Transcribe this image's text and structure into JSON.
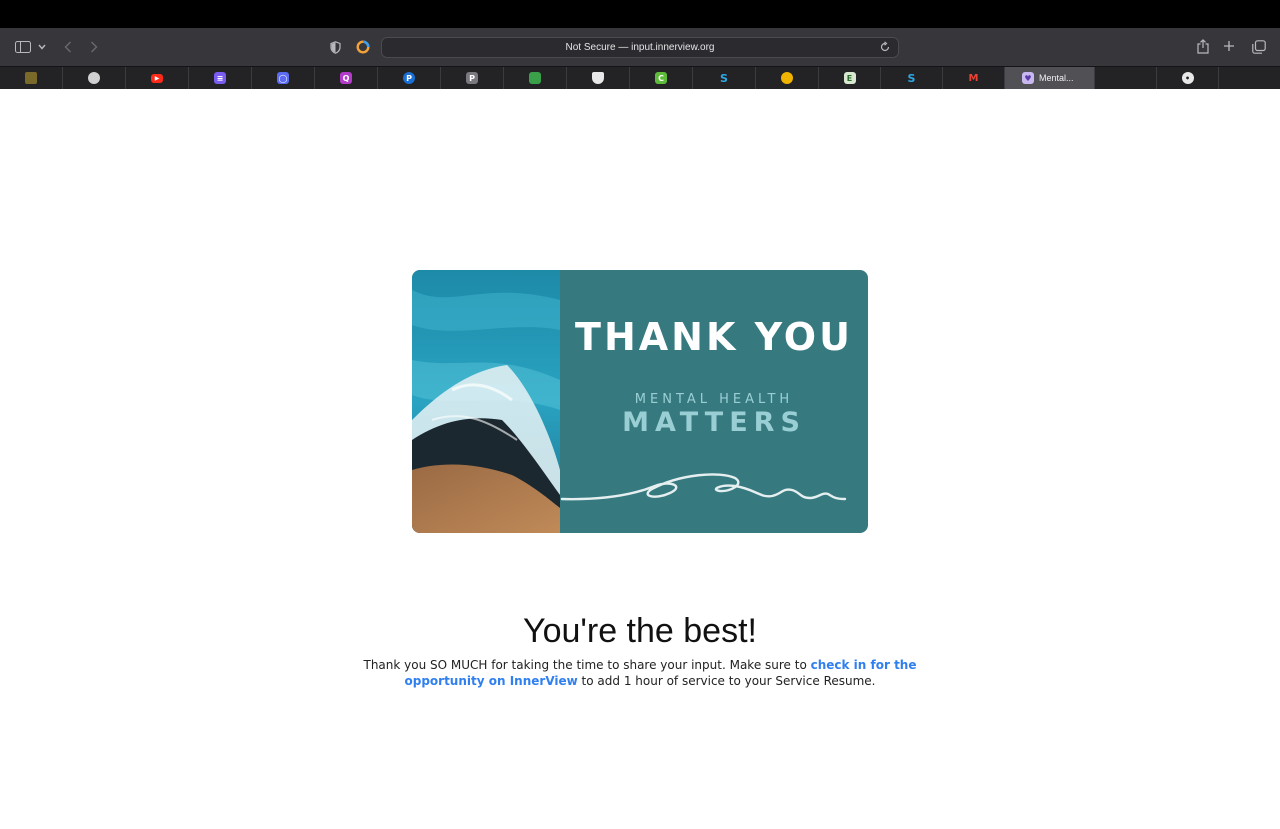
{
  "browser": {
    "address": "Not Secure — input.innerview.org",
    "favorites": [
      {
        "icon": "car-icon",
        "color": "#c8a04a",
        "glyph": ""
      },
      {
        "icon": "wheel-icon",
        "color": "#d0d0d0",
        "glyph": ""
      },
      {
        "icon": "youtube-icon",
        "color": "#ff2a1a",
        "glyph": "▶"
      },
      {
        "icon": "list-icon",
        "color": "#7a5cf0",
        "glyph": "≡"
      },
      {
        "icon": "circle-app-icon",
        "color": "#5b6cf3",
        "glyph": "◯"
      },
      {
        "icon": "q-app-icon",
        "color": "#b23cc9",
        "glyph": "Q"
      },
      {
        "icon": "p-round-icon",
        "color": "#1a6fd4",
        "glyph": "P"
      },
      {
        "icon": "p-square-icon",
        "color": "#7a7a7e",
        "glyph": "P"
      },
      {
        "icon": "classroom-icon",
        "color": "#3aa14a",
        "glyph": ""
      },
      {
        "icon": "shield-crest-icon",
        "color": "#e8e8e8",
        "glyph": ""
      },
      {
        "icon": "c-app-icon",
        "color": "#5fbb3a",
        "glyph": "C"
      },
      {
        "icon": "s-app-icon",
        "color": "#2ea8e6",
        "glyph": "S"
      },
      {
        "icon": "chrome-like-icon",
        "color": "#f0b400",
        "glyph": ""
      },
      {
        "icon": "e-app-icon",
        "color": "#d8e8d0",
        "glyph": "E"
      },
      {
        "icon": "s-app-icon-2",
        "color": "#2ea8e6",
        "glyph": "S"
      },
      {
        "icon": "gmail-icon",
        "color": "#232326",
        "glyph": "M"
      }
    ],
    "active_tab_label": "Mental...",
    "extra_icons": [
      "dog-face-icon",
      "apple-icon"
    ]
  },
  "card": {
    "title": "THANK YOU",
    "line1": "MENTAL HEALTH",
    "line2": "MATTERS"
  },
  "main": {
    "headline": "You're the best!",
    "message_pre": "Thank you SO MUCH for taking the time to share your input. Make sure to ",
    "message_link": "check in for the opportunity on InnerView",
    "message_post": " to add 1 hour of service to your Service Resume."
  }
}
